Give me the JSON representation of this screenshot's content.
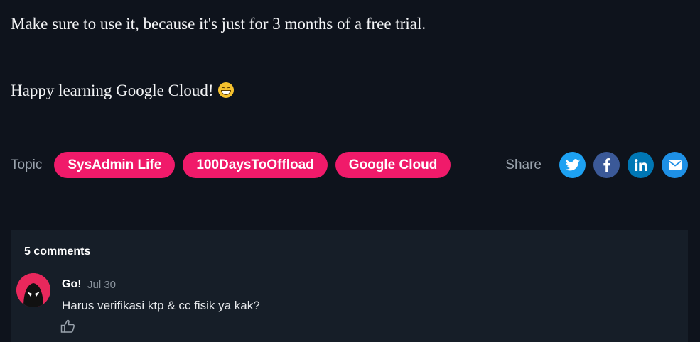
{
  "article": {
    "paragraph_1": "Make sure to use it, because it's just for 3 months of a free trial.",
    "paragraph_2": "Happy learning Google Cloud!",
    "emoji": "grinning-face-icon"
  },
  "topics": {
    "label": "Topic",
    "tags": [
      "SysAdmin Life",
      "100DaysToOffload",
      "Google Cloud"
    ]
  },
  "share": {
    "label": "Share",
    "buttons": [
      {
        "name": "twitter-icon",
        "color": "#1da1f2"
      },
      {
        "name": "facebook-icon",
        "color": "#3b5998"
      },
      {
        "name": "linkedin-icon",
        "color": "#0077b5"
      },
      {
        "name": "email-icon",
        "color": "#1e90e6"
      }
    ]
  },
  "comments": {
    "count_label": "5 comments",
    "items": [
      {
        "author": "Go!",
        "date": "Jul 30",
        "text": "Harus verifikasi ktp & cc fisik ya kak?",
        "avatar_icon": "avatar-icon",
        "like_icon": "thumbs-up-icon"
      }
    ]
  },
  "colors": {
    "background": "#0e131c",
    "tag_accent": "#f01a6a",
    "comments_panel": "#161e28"
  }
}
